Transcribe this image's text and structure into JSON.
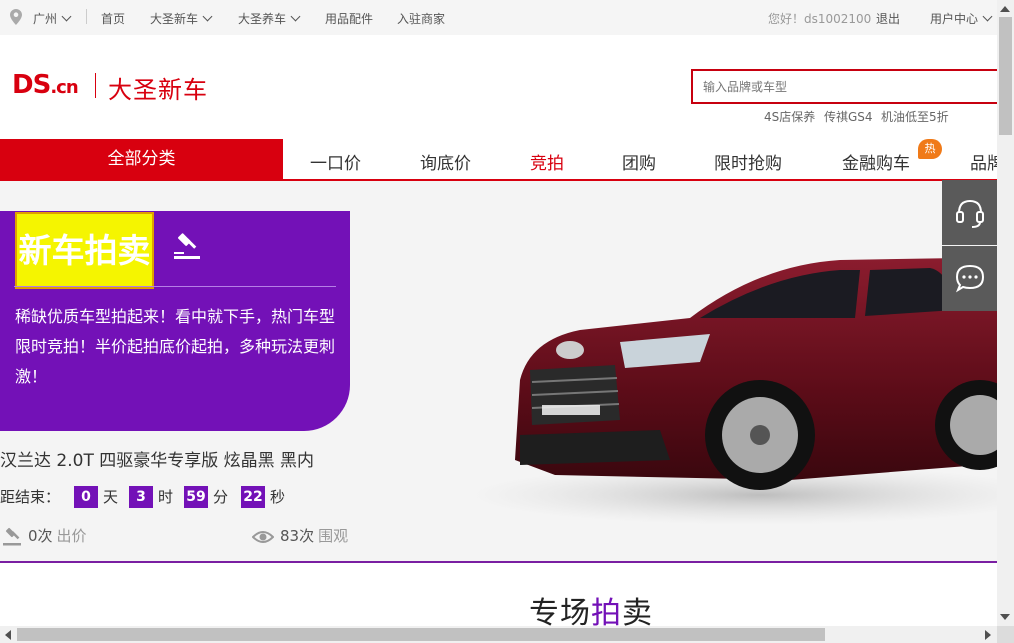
{
  "topbar": {
    "city": "广州",
    "links": [
      "首页",
      "大圣新车",
      "大圣养车",
      "用品配件",
      "入驻商家"
    ],
    "greeting": "您好！ds1002100",
    "logout": "退出",
    "user_center": "用户中心"
  },
  "header": {
    "logo_text": "DS",
    "logo_suffix": ".cn",
    "site_title": "大圣新车",
    "search_placeholder": "输入品牌或车型",
    "hot_keywords": [
      "4S店保养",
      "传祺GS4",
      "机油低至5折"
    ]
  },
  "nav": {
    "all_categories": "全部分类",
    "items": [
      "一口价",
      "询底价",
      "竞拍",
      "团购",
      "限时抢购",
      "金融购车",
      "品牌"
    ],
    "active": "竞拍",
    "hot_badge": "热"
  },
  "promo": {
    "title": "新车拍卖",
    "description": "稀缺优质车型拍起来！看中就下手，热门车型限时竞拍！半价起拍底价起拍，多种玩法更刺激！"
  },
  "auction": {
    "model": "汉兰达 2.0T 四驱豪华专享版 炫晶黑 黑内",
    "countdown_label": "距结束：",
    "days": "0",
    "day_unit": "天",
    "hours": "3",
    "hour_unit": "时",
    "minutes": "59",
    "minute_unit": "分",
    "seconds": "22",
    "second_unit": "秒",
    "bids_count": "0次",
    "bids_label": "出价",
    "views_count": "83次",
    "views_label": "围观"
  },
  "section": {
    "title_prefix": "专场",
    "title_accent": "拍",
    "title_suffix": "卖"
  },
  "colors": {
    "brand_red": "#d8000f",
    "auction_purple": "#7311b7",
    "promo_yellow": "#f5f500"
  }
}
